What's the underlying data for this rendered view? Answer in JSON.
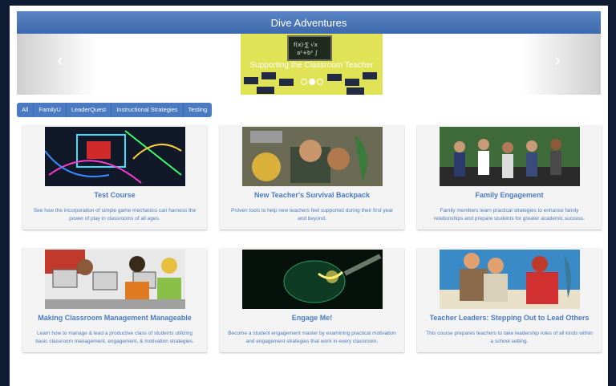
{
  "header": {
    "title": "Dive Adventures"
  },
  "carousel": {
    "caption": "Supporting the Classroom Teacher",
    "dot_count": 3,
    "active_dot": 1
  },
  "filters": [
    "All",
    "FamilyU",
    "LeaderQuest",
    "Instructional Strategies",
    "Testing"
  ],
  "courses": [
    {
      "title": "Test Course",
      "description": "See how the incorporation of simple game mechanics can harness the power of play in classrooms of all ages."
    },
    {
      "title": "New Teacher's Survival Backpack",
      "description": "Proven tools to help new teachers feel supported during their first year and beyond."
    },
    {
      "title": "Family Engagement",
      "description": "Family members learn practical strategies to enhance family relationships and prepare students for greater academic success."
    },
    {
      "title": "Making Classroom Management Manageable",
      "description": "Learn how to manage & lead a productive class of students utilizing basic classroom management, engagement, & motivation strategies."
    },
    {
      "title": "Engage Me!",
      "description": "Become a student engagement master by examining practical motivation and engagement strategies that work in every classroom."
    },
    {
      "title": "Teacher Leaders: Stepping Out to Lead Others",
      "description": "This course prepares teachers to take leadership roles of all kinds within a school setting."
    }
  ],
  "colors": {
    "accent": "#4a7bc2",
    "header": "#3d6aae",
    "slide_bg": "#e1e357",
    "frame": "#0f1b33"
  }
}
